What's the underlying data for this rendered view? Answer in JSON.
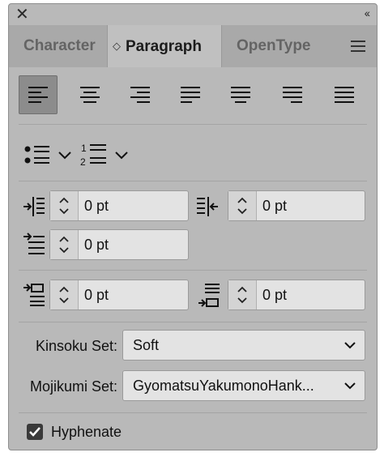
{
  "tabs": [
    {
      "label": "Character",
      "active": false
    },
    {
      "label": "Paragraph",
      "active": true
    },
    {
      "label": "OpenType",
      "active": false
    }
  ],
  "alignment": {
    "buttons": [
      "align-left",
      "align-center",
      "align-right",
      "justify-last-left",
      "justify-last-center",
      "justify-last-right",
      "justify-all"
    ],
    "selected": "align-left"
  },
  "indents": {
    "left_indent": "0 pt",
    "right_indent": "0 pt",
    "first_line_indent": "0 pt",
    "space_before": "0 pt",
    "space_after": "0 pt"
  },
  "kinsoku": {
    "label": "Kinsoku Set:",
    "value": "Soft"
  },
  "mojikumi": {
    "label": "Mojikumi Set:",
    "value": "GyomatsuYakumonoHank..."
  },
  "hyphenate": {
    "label": "Hyphenate",
    "checked": true
  },
  "colors": {
    "panel": "#b9b9b9",
    "field": "#e3e3e3",
    "selected": "#8c8c8c"
  }
}
